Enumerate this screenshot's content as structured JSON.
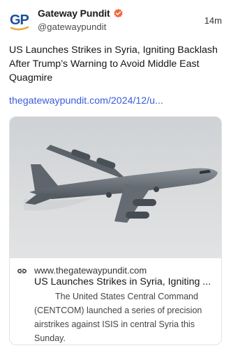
{
  "post": {
    "author": {
      "display_name": "Gateway Pundit",
      "handle": "@gatewaypundit",
      "avatar_text": "GP",
      "verified": true
    },
    "timestamp": "14m",
    "headline": "US Launches Strikes in Syria, Igniting Backlash After Trump’s Warning to Avoid Middle East Quagmire",
    "link_text": "thegatewaypundit.com/2024/12/u...",
    "link_card": {
      "image_subject": "B-52 bomber in flight",
      "icon": "link-icon",
      "domain": "www.thegatewaypundit.com",
      "title": "US Launches Strikes in Syria, Igniting ...",
      "description": "The United States Central Command (CENTCOM) launched a series of precision airstrikes against ISIS in central Syria this Sunday."
    }
  },
  "colors": {
    "brand_blue": "#1d4f9c",
    "brand_gold": "#e8a33c",
    "verified_orange": "#f2673a",
    "link_blue": "#3b5bd9",
    "sky": "#d6d8da",
    "aircraft": "#6b7279"
  }
}
